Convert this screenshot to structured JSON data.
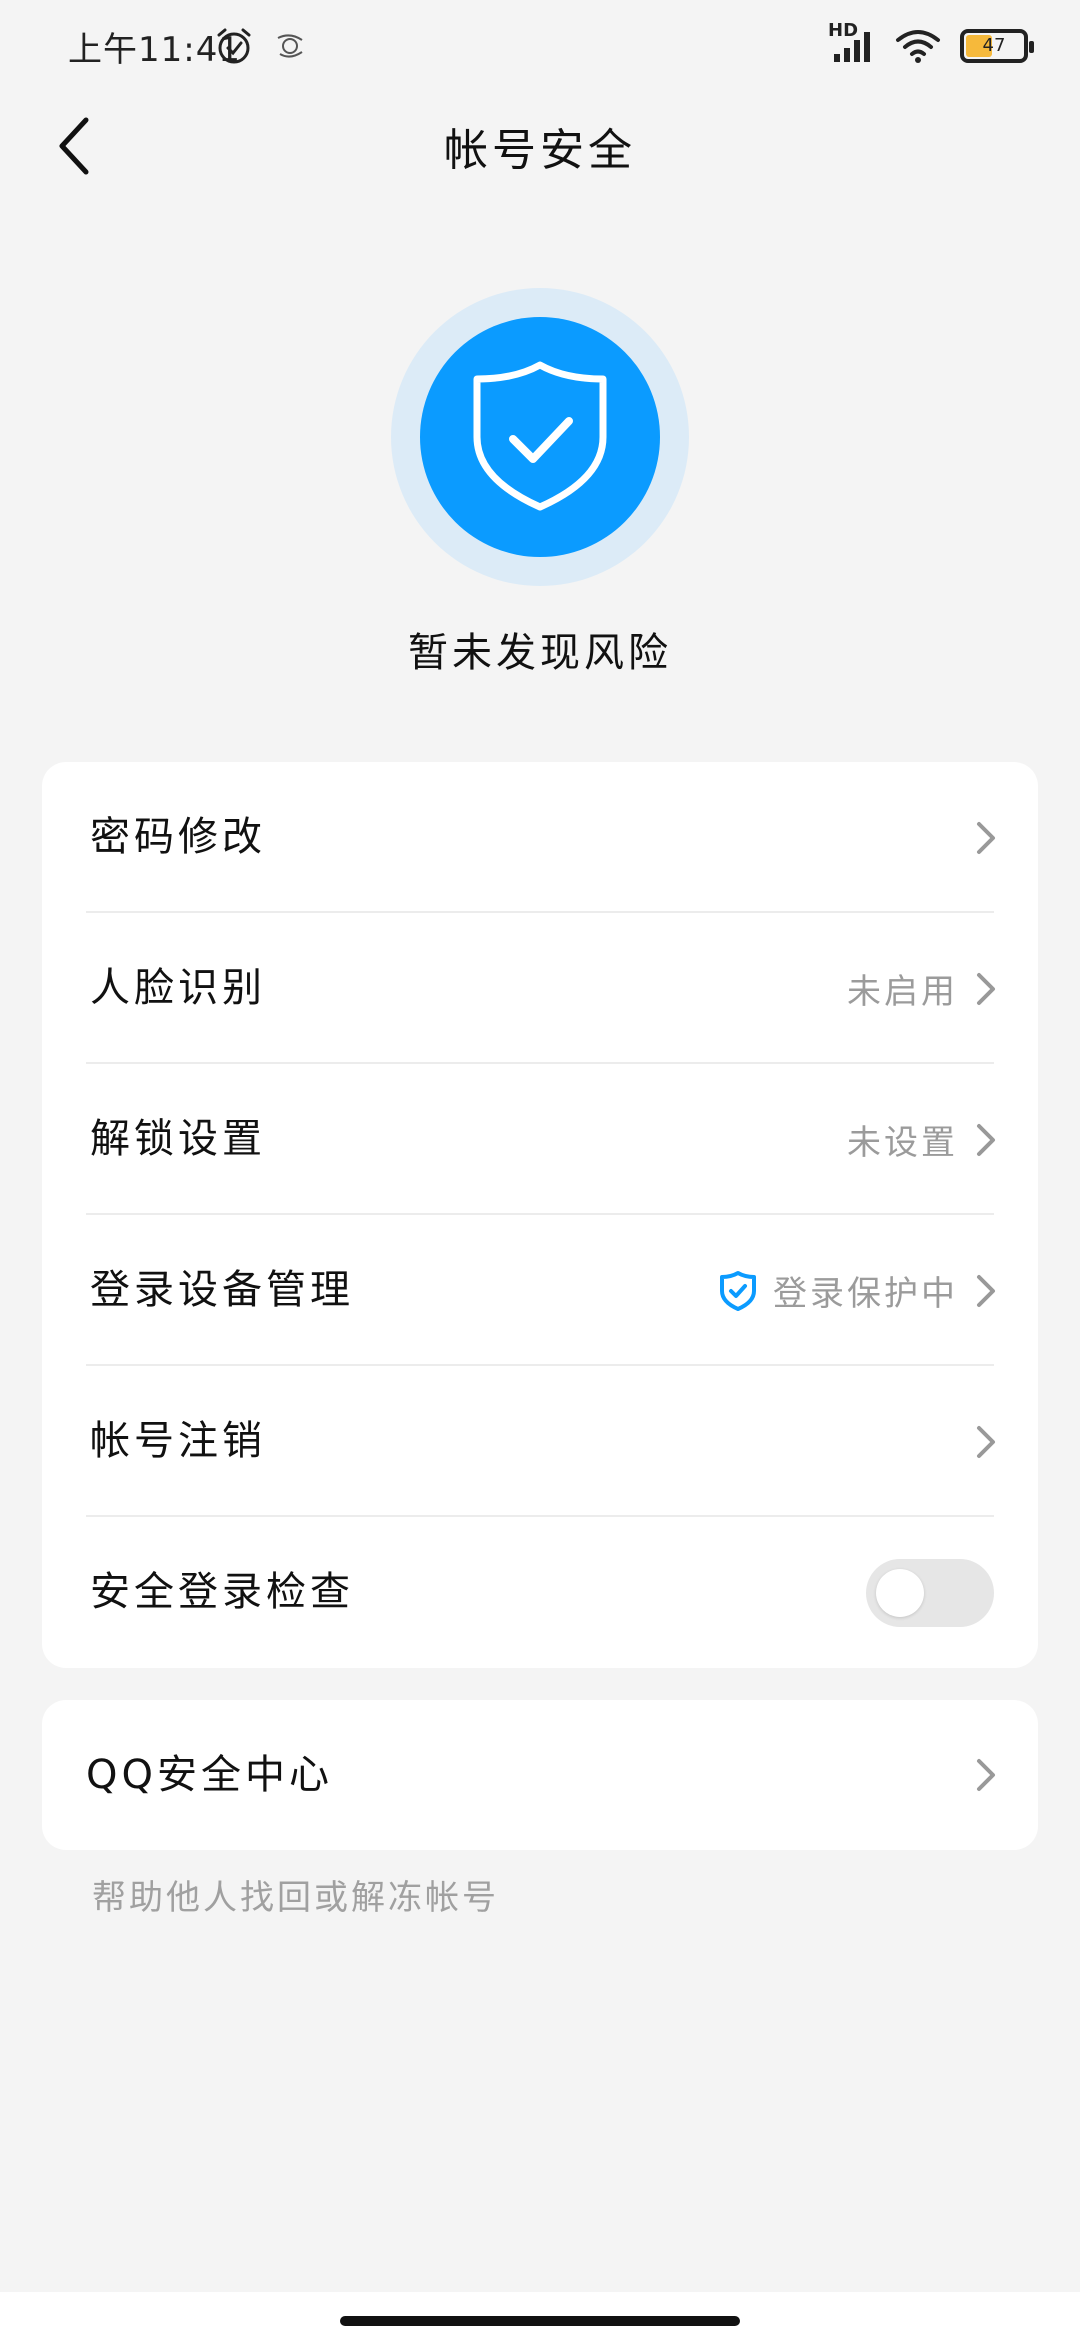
{
  "status_bar": {
    "time": "上午11:41",
    "hd_label": "HD",
    "battery_percent": 47,
    "battery_label": "47"
  },
  "header": {
    "title": "帐号安全"
  },
  "hero": {
    "status": "暂未发现风险"
  },
  "settings": {
    "password": {
      "label": "密码修改"
    },
    "face_recognition": {
      "label": "人脸识别",
      "value": "未启用"
    },
    "unlock": {
      "label": "解锁设置",
      "value": "未设置"
    },
    "login_devices": {
      "label": "登录设备管理",
      "value": "登录保护中"
    },
    "account_cancel": {
      "label": "帐号注销"
    },
    "safe_login_check": {
      "label": "安全登录检查",
      "enabled": false
    }
  },
  "qq_security": {
    "label": "QQ安全中心",
    "helper": "帮助他人找回或解冻帐号"
  },
  "colors": {
    "accent": "#0b9bff",
    "shield_halo": "#dcebf7",
    "background": "#f4f4f4",
    "secondary_text": "#9b9b9b"
  }
}
